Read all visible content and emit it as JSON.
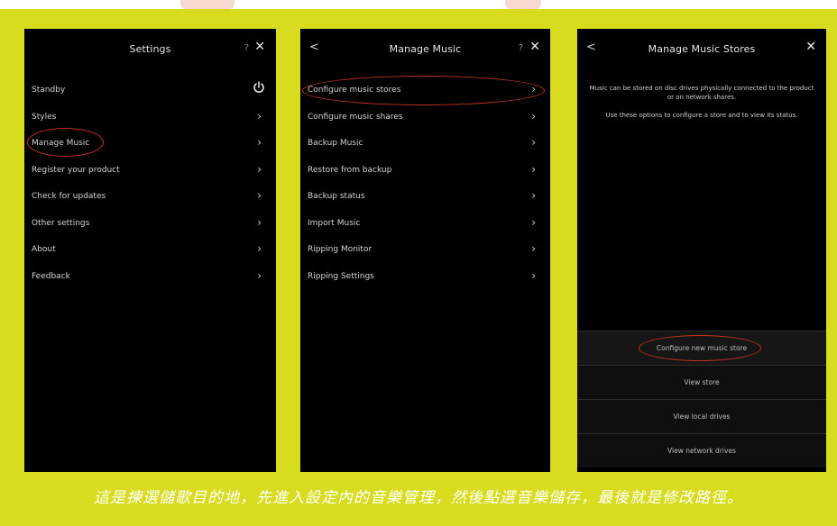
{
  "screen1": {
    "title": "Settings",
    "help": "?",
    "close": "✕",
    "items": [
      {
        "label": "Standby",
        "icon": "power-icon"
      },
      {
        "label": "Styles"
      },
      {
        "label": "Manage Music"
      },
      {
        "label": "Register your product"
      },
      {
        "label": "Check for updates"
      },
      {
        "label": "Other settings"
      },
      {
        "label": "About"
      },
      {
        "label": "Feedback"
      }
    ]
  },
  "screen2": {
    "title": "Manage Music",
    "back": "<",
    "help": "?",
    "close": "✕",
    "items": [
      {
        "label": "Configure music stores"
      },
      {
        "label": "Configure music shares"
      },
      {
        "label": "Backup Music"
      },
      {
        "label": "Restore from backup"
      },
      {
        "label": "Backup status"
      },
      {
        "label": "Import Music"
      },
      {
        "label": "Ripping Monitor"
      },
      {
        "label": "Ripping Settings"
      }
    ]
  },
  "screen3": {
    "title": "Manage Music Stores",
    "back": "<",
    "close": "✕",
    "description": [
      "Music can be stored on disc drives physically connected to the product or on network shares.",
      "Use these options to configure a store and to view its status."
    ],
    "actions": [
      "Configure new music store",
      "View store",
      "View local drives",
      "View network drives"
    ]
  },
  "caption": "這是揀選儲歌目的地，先進入設定內的音樂管理，然後點選音樂儲存，最後就是修改路徑。",
  "colors": {
    "background": "#d7dc1f",
    "panel": "#000000",
    "highlight": "#c4321f"
  }
}
